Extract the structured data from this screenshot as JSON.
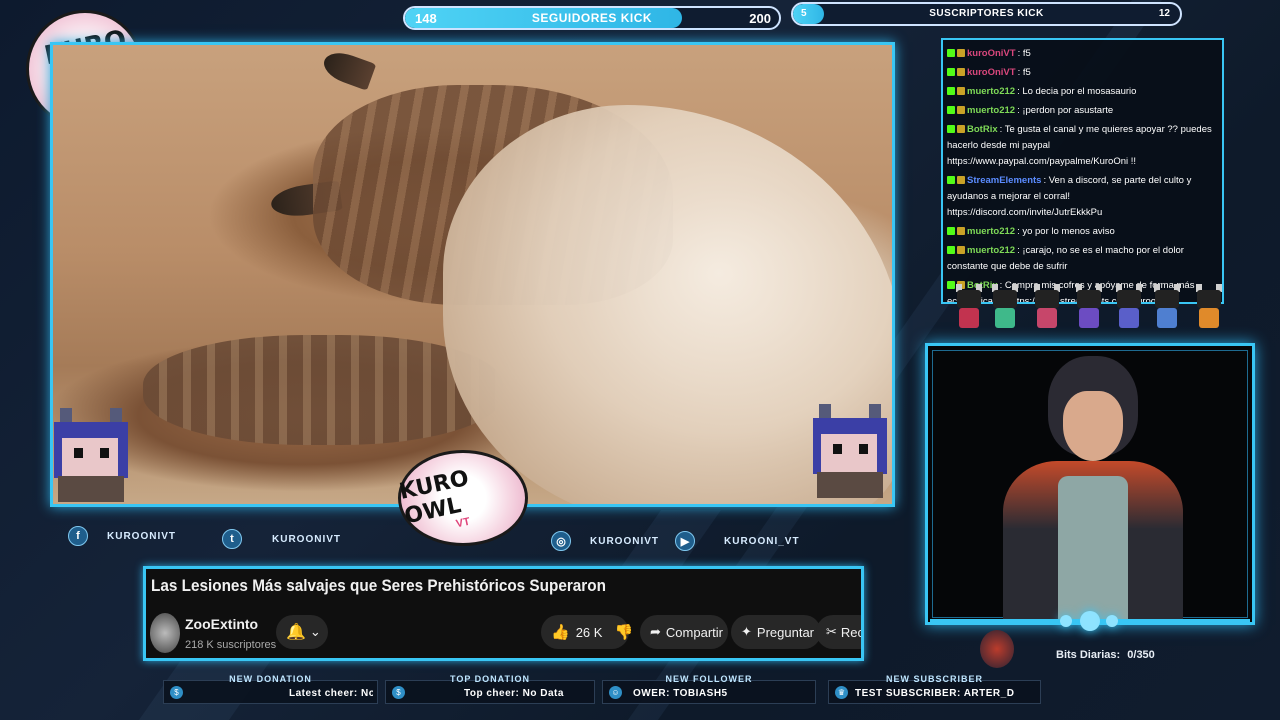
{
  "top_bars": {
    "followers": {
      "current": "148",
      "label": "SEGUIDORES KICK",
      "goal": "200",
      "progress": 0.74
    },
    "subscribers": {
      "current": "5",
      "label": "SUSCRIPTORES KICK",
      "goal": "12",
      "progress": 0.42
    }
  },
  "social": {
    "facebook": "KUROONIVT",
    "twitter": "KUROONIVT",
    "instagram": "KUROONIVT",
    "youtube": "KUROONI_VT"
  },
  "video_info": {
    "title": "Las Lesiones Más salvajes que Seres Prehistóricos Superaron",
    "channel": "ZooExtinto",
    "subscribers": "218 K suscriptores",
    "likes": "26 K",
    "share": "Compartir",
    "ask": "Preguntar",
    "clip": "Rec"
  },
  "chat": [
    {
      "user": "kuroOniVT",
      "color": "#d9477c",
      "text": ": f5"
    },
    {
      "user": "kuroOniVT",
      "color": "#d9477c",
      "text": ": f5"
    },
    {
      "user": "muerto212",
      "color": "#7ed957",
      "text": ": Lo decia por el mosasaurio"
    },
    {
      "user": "muerto212",
      "color": "#7ed957",
      "text": ": ¡perdon por asustarte"
    },
    {
      "user": "BotRix",
      "color": "#7ed957",
      "text": ": Te gusta el canal y me quieres apoyar ?? puedes hacerlo desde mi paypal https://www.paypal.com/paypalme/KuroOni !!"
    },
    {
      "user": "StreamElements",
      "color": "#5b8cff",
      "text": ": Ven a discord, se parte del culto y ayudanos a mejorar el corral! https://discord.com/invite/JutrEkkkPu"
    },
    {
      "user": "muerto212",
      "color": "#7ed957",
      "text": ": yo por lo menos aviso"
    },
    {
      "user": "muerto212",
      "color": "#7ed957",
      "text": ": ¡carajo, no se es el macho por el dolor constante que debe de sufrir"
    },
    {
      "user": "BotRix",
      "color": "#7ed957",
      "text": ": Compra mis cofres y apóyame de forma más económica en https://www.streamloots.com/kurooniivt"
    },
    {
      "user": "",
      "color": "#7ed957",
      "text": "mar"
    }
  ],
  "alerts": {
    "new_donation": {
      "header": "NEW DONATION",
      "value": "Latest cheer: No"
    },
    "top_donation": {
      "header": "TOP DONATION",
      "value": "Top cheer: No Data"
    },
    "new_follower": {
      "header": "NEW FOLLOWER",
      "value": "OWER: TOBIASH5"
    },
    "new_subscriber": {
      "header": "NEW SUBSCRIBER",
      "value": "TEST SUBSCRIBER: ARTER_D"
    }
  },
  "bits": {
    "label": "Bits Diarias:",
    "value": "0/350"
  },
  "colors": {
    "accent": "#39c6f4",
    "bar_fill": "#4fd3f5"
  }
}
